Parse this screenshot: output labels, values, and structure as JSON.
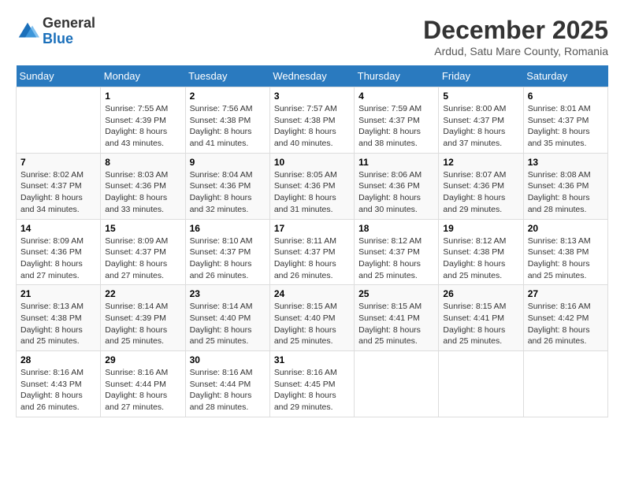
{
  "header": {
    "logo": {
      "general": "General",
      "blue": "Blue"
    },
    "title": "December 2025",
    "subtitle": "Ardud, Satu Mare County, Romania"
  },
  "days_of_week": [
    "Sunday",
    "Monday",
    "Tuesday",
    "Wednesday",
    "Thursday",
    "Friday",
    "Saturday"
  ],
  "weeks": [
    [
      {
        "day": "",
        "sunrise": "",
        "sunset": "",
        "daylight": ""
      },
      {
        "day": "1",
        "sunrise": "7:55 AM",
        "sunset": "4:39 PM",
        "daylight": "8 hours and 43 minutes."
      },
      {
        "day": "2",
        "sunrise": "7:56 AM",
        "sunset": "4:38 PM",
        "daylight": "8 hours and 41 minutes."
      },
      {
        "day": "3",
        "sunrise": "7:57 AM",
        "sunset": "4:38 PM",
        "daylight": "8 hours and 40 minutes."
      },
      {
        "day": "4",
        "sunrise": "7:59 AM",
        "sunset": "4:37 PM",
        "daylight": "8 hours and 38 minutes."
      },
      {
        "day": "5",
        "sunrise": "8:00 AM",
        "sunset": "4:37 PM",
        "daylight": "8 hours and 37 minutes."
      },
      {
        "day": "6",
        "sunrise": "8:01 AM",
        "sunset": "4:37 PM",
        "daylight": "8 hours and 35 minutes."
      }
    ],
    [
      {
        "day": "7",
        "sunrise": "8:02 AM",
        "sunset": "4:37 PM",
        "daylight": "8 hours and 34 minutes."
      },
      {
        "day": "8",
        "sunrise": "8:03 AM",
        "sunset": "4:36 PM",
        "daylight": "8 hours and 33 minutes."
      },
      {
        "day": "9",
        "sunrise": "8:04 AM",
        "sunset": "4:36 PM",
        "daylight": "8 hours and 32 minutes."
      },
      {
        "day": "10",
        "sunrise": "8:05 AM",
        "sunset": "4:36 PM",
        "daylight": "8 hours and 31 minutes."
      },
      {
        "day": "11",
        "sunrise": "8:06 AM",
        "sunset": "4:36 PM",
        "daylight": "8 hours and 30 minutes."
      },
      {
        "day": "12",
        "sunrise": "8:07 AM",
        "sunset": "4:36 PM",
        "daylight": "8 hours and 29 minutes."
      },
      {
        "day": "13",
        "sunrise": "8:08 AM",
        "sunset": "4:36 PM",
        "daylight": "8 hours and 28 minutes."
      }
    ],
    [
      {
        "day": "14",
        "sunrise": "8:09 AM",
        "sunset": "4:36 PM",
        "daylight": "8 hours and 27 minutes."
      },
      {
        "day": "15",
        "sunrise": "8:09 AM",
        "sunset": "4:37 PM",
        "daylight": "8 hours and 27 minutes."
      },
      {
        "day": "16",
        "sunrise": "8:10 AM",
        "sunset": "4:37 PM",
        "daylight": "8 hours and 26 minutes."
      },
      {
        "day": "17",
        "sunrise": "8:11 AM",
        "sunset": "4:37 PM",
        "daylight": "8 hours and 26 minutes."
      },
      {
        "day": "18",
        "sunrise": "8:12 AM",
        "sunset": "4:37 PM",
        "daylight": "8 hours and 25 minutes."
      },
      {
        "day": "19",
        "sunrise": "8:12 AM",
        "sunset": "4:38 PM",
        "daylight": "8 hours and 25 minutes."
      },
      {
        "day": "20",
        "sunrise": "8:13 AM",
        "sunset": "4:38 PM",
        "daylight": "8 hours and 25 minutes."
      }
    ],
    [
      {
        "day": "21",
        "sunrise": "8:13 AM",
        "sunset": "4:38 PM",
        "daylight": "8 hours and 25 minutes."
      },
      {
        "day": "22",
        "sunrise": "8:14 AM",
        "sunset": "4:39 PM",
        "daylight": "8 hours and 25 minutes."
      },
      {
        "day": "23",
        "sunrise": "8:14 AM",
        "sunset": "4:40 PM",
        "daylight": "8 hours and 25 minutes."
      },
      {
        "day": "24",
        "sunrise": "8:15 AM",
        "sunset": "4:40 PM",
        "daylight": "8 hours and 25 minutes."
      },
      {
        "day": "25",
        "sunrise": "8:15 AM",
        "sunset": "4:41 PM",
        "daylight": "8 hours and 25 minutes."
      },
      {
        "day": "26",
        "sunrise": "8:15 AM",
        "sunset": "4:41 PM",
        "daylight": "8 hours and 25 minutes."
      },
      {
        "day": "27",
        "sunrise": "8:16 AM",
        "sunset": "4:42 PM",
        "daylight": "8 hours and 26 minutes."
      }
    ],
    [
      {
        "day": "28",
        "sunrise": "8:16 AM",
        "sunset": "4:43 PM",
        "daylight": "8 hours and 26 minutes."
      },
      {
        "day": "29",
        "sunrise": "8:16 AM",
        "sunset": "4:44 PM",
        "daylight": "8 hours and 27 minutes."
      },
      {
        "day": "30",
        "sunrise": "8:16 AM",
        "sunset": "4:44 PM",
        "daylight": "8 hours and 28 minutes."
      },
      {
        "day": "31",
        "sunrise": "8:16 AM",
        "sunset": "4:45 PM",
        "daylight": "8 hours and 29 minutes."
      },
      {
        "day": "",
        "sunrise": "",
        "sunset": "",
        "daylight": ""
      },
      {
        "day": "",
        "sunrise": "",
        "sunset": "",
        "daylight": ""
      },
      {
        "day": "",
        "sunrise": "",
        "sunset": "",
        "daylight": ""
      }
    ]
  ],
  "labels": {
    "sunrise_prefix": "Sunrise: ",
    "sunset_prefix": "Sunset: ",
    "daylight_prefix": "Daylight: "
  }
}
